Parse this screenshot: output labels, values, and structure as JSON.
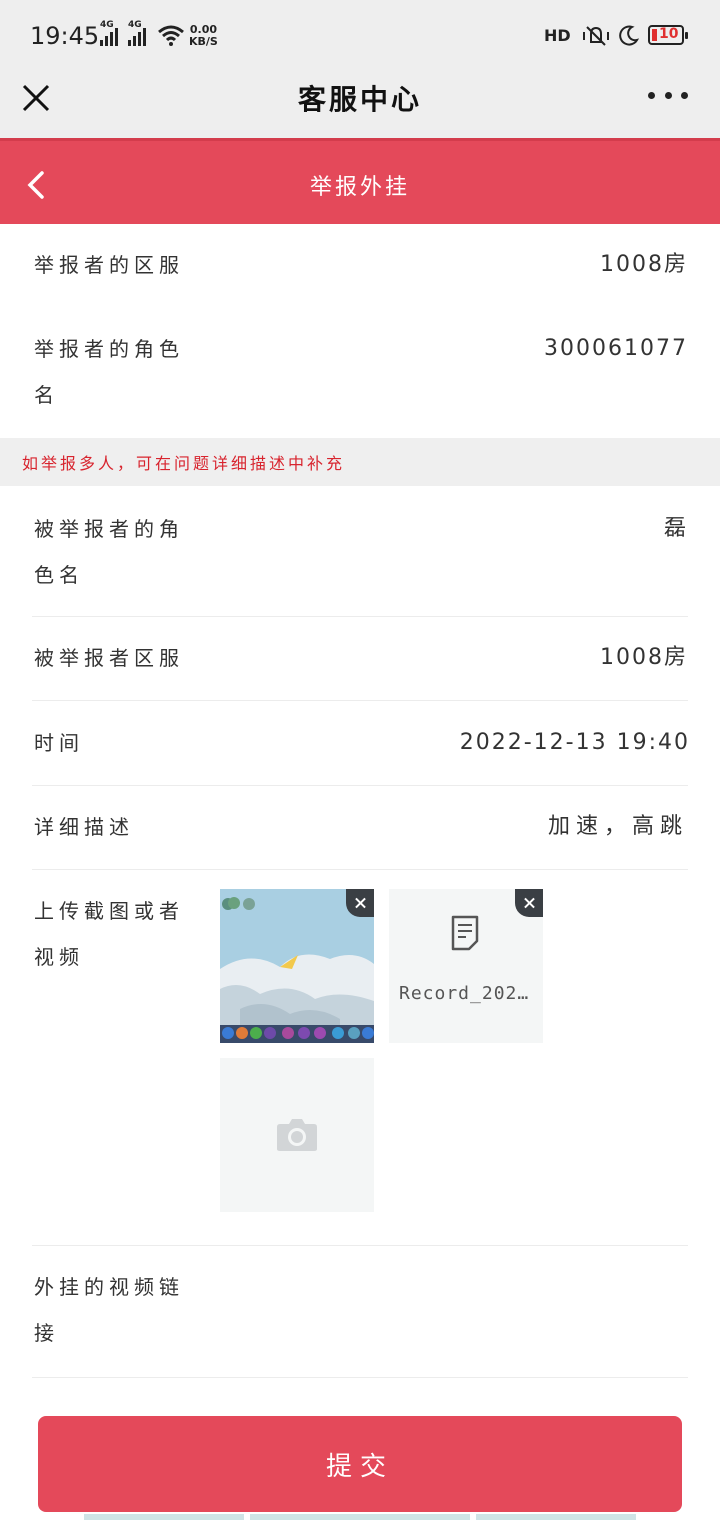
{
  "status": {
    "time": "19:45",
    "network_a": "4G",
    "network_b": "4G",
    "speed_value": "0.00",
    "speed_unit": "KB/S",
    "hd": "HD",
    "battery": "10"
  },
  "nav": {
    "title": "客服中心"
  },
  "header": {
    "title": "举报外挂"
  },
  "form": {
    "reporter_server_label": "举报者的区服",
    "reporter_server_value": "1008房",
    "reporter_role_label": "举报者的角色名",
    "reporter_role_value": "300061077",
    "notice": "如举报多人，可在问题详细描述中补充",
    "reported_role_label": "被举报者的角色名",
    "reported_role_value": "磊",
    "reported_server_label": "被举报者区服",
    "reported_server_value": "1008房",
    "time_label": "时间",
    "time_value": "2022-12-13 19:40",
    "desc_label": "详细描述",
    "desc_value": "加速，高跳",
    "upload_label": "上传截图或者视频",
    "record_name": "Record_202…",
    "video_link_label": "外挂的视频链接"
  },
  "icons": {
    "close": "close-icon",
    "more": "more-icon",
    "back": "back-icon",
    "document": "document-icon",
    "camera": "camera-icon"
  },
  "colors": {
    "accent": "#e4495a",
    "notice_text": "#d8242e"
  },
  "submit": {
    "label": "提交"
  }
}
